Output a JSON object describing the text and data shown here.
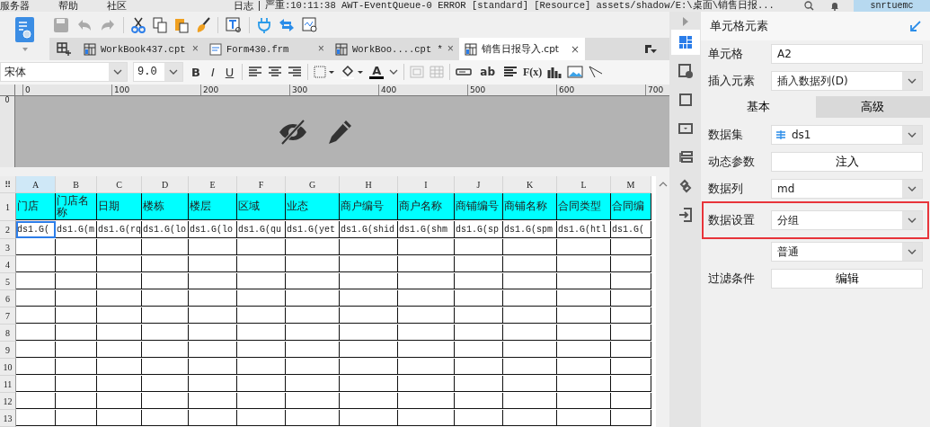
{
  "menu": [
    "服务器",
    "帮助",
    "社区"
  ],
  "log": {
    "label": "日志",
    "message": "严重:10:11:38 AWT-EventQueue-0 ERROR [standard] [Resource] assets/shadow/E:\\桌面\\销售日报..."
  },
  "user": "snrtuemc",
  "file_tabs": [
    {
      "label": "WorkBook437.cpt",
      "kind": "report",
      "close": "×",
      "selected": false
    },
    {
      "label": "Form430.frm",
      "kind": "form",
      "close": "×",
      "selected": false
    },
    {
      "label": "WorkBoo....cpt *",
      "kind": "report",
      "close": "×",
      "selected": false
    },
    {
      "label": "销售日报导入.cpt",
      "kind": "report",
      "close": "×",
      "selected": true
    }
  ],
  "format_bar": {
    "font": "宋体",
    "size": "9.0",
    "bold": "B",
    "italic": "I",
    "underline": "U",
    "font_color": "A",
    "text_tool": "ab",
    "formula": "F(x)"
  },
  "ruler": {
    "labels": [
      "0",
      "100",
      "200",
      "300",
      "400",
      "500",
      "600",
      "700"
    ],
    "vertical_label": "0"
  },
  "sheet": {
    "corner": "⠿",
    "columns": [
      {
        "letter": "A",
        "header": "门店",
        "value": "ds1.G(",
        "selected": true
      },
      {
        "letter": "B",
        "header": "门店名称",
        "value": "ds1.G(m",
        "selected": false
      },
      {
        "letter": "C",
        "header": "日期",
        "value": "ds1.G(rq",
        "selected": false
      },
      {
        "letter": "D",
        "header": "楼栋",
        "value": "ds1.G(lo",
        "selected": false
      },
      {
        "letter": "E",
        "header": "楼层",
        "value": "ds1.G(lo",
        "selected": false
      },
      {
        "letter": "F",
        "header": "区域",
        "value": "ds1.G(qu",
        "selected": false
      },
      {
        "letter": "G",
        "header": "业态",
        "value": "ds1.G(yet",
        "selected": false
      },
      {
        "letter": "H",
        "header": "商户编号",
        "value": "ds1.G(shid",
        "selected": false
      },
      {
        "letter": "I",
        "header": "商户名称",
        "value": "ds1.G(shm",
        "selected": false
      },
      {
        "letter": "J",
        "header": "商铺编号",
        "value": "ds1.G(sp",
        "selected": false
      },
      {
        "letter": "K",
        "header": "商铺名称",
        "value": "ds1.G(spm",
        "selected": false
      },
      {
        "letter": "L",
        "header": "合同类型",
        "value": "ds1.G(htl",
        "selected": false
      },
      {
        "letter": "M",
        "header": "合同编",
        "value": "ds1.G(",
        "selected": false
      }
    ],
    "rows": [
      "1",
      "2",
      "3",
      "4",
      "5",
      "6",
      "7",
      "8",
      "9",
      "10",
      "11",
      "12",
      "13"
    ]
  },
  "side_tools": [
    {
      "kind": "cell",
      "selected": true
    },
    {
      "kind": "info",
      "selected": false
    },
    {
      "kind": "frame",
      "selected": false
    },
    {
      "kind": "widget",
      "selected": false
    },
    {
      "kind": "layout",
      "selected": false
    },
    {
      "kind": "link",
      "selected": false
    },
    {
      "kind": "import",
      "selected": false
    }
  ],
  "panel": {
    "title": "单元格元素",
    "cell_label": "单元格",
    "cell_value": "A2",
    "insert_label": "插入元素",
    "insert_value": "插入数据列(D)",
    "tabs": [
      {
        "label": "基本",
        "selected": true
      },
      {
        "label": "高级",
        "selected": false
      }
    ],
    "props": [
      {
        "label": "数据集",
        "kind": "dataset",
        "value": "ds1",
        "highlighted": false
      },
      {
        "label": "动态参数",
        "kind": "button",
        "value": "注入",
        "highlighted": false
      },
      {
        "label": "数据列",
        "kind": "dropdown",
        "value": "md",
        "highlighted": false
      },
      {
        "label": "数据设置",
        "kind": "dropdown",
        "value": "分组",
        "highlighted": true
      },
      {
        "kind": "dropdown",
        "value": "普通",
        "highlighted": false
      },
      {
        "label": "过滤条件",
        "kind": "button",
        "value": "编辑",
        "highlighted": false
      }
    ]
  }
}
